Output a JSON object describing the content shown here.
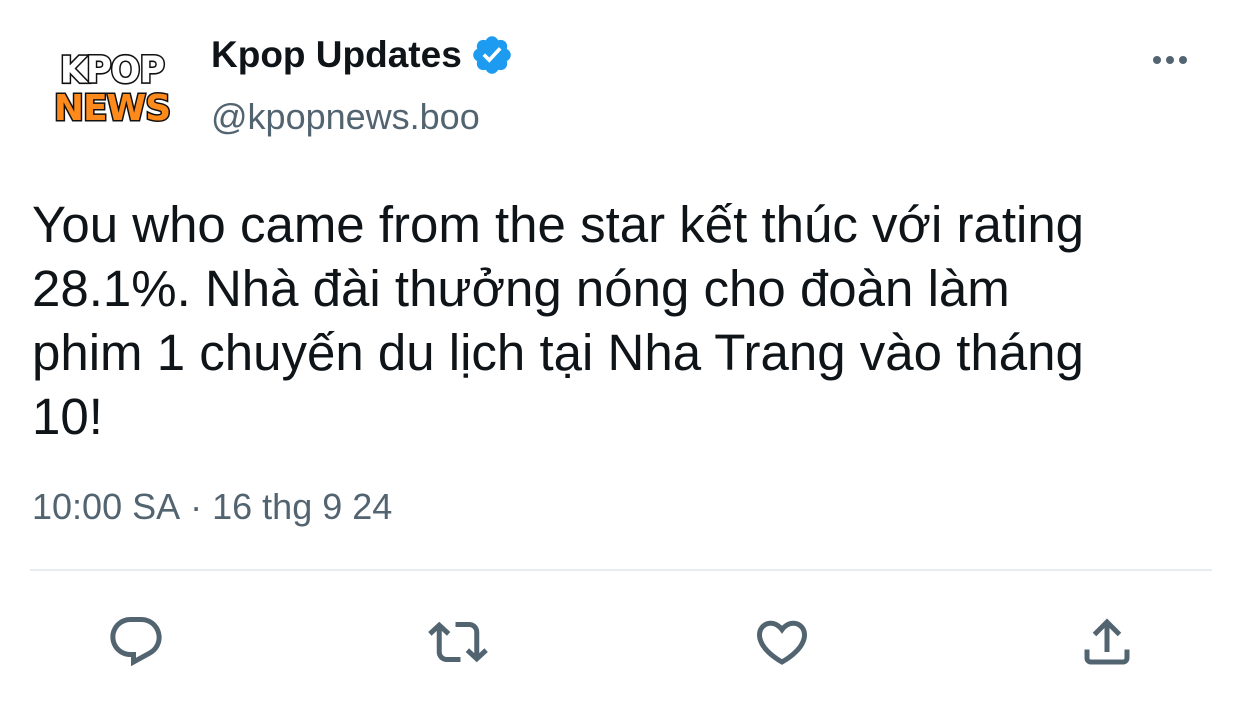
{
  "tweet": {
    "avatar": {
      "line1": "KPOP",
      "line2": "NEWS",
      "colors": {
        "line1": "#ffffff",
        "line2": "#ff8a1c",
        "outline": "#111111"
      }
    },
    "author": {
      "display_name": "Kpop Updates",
      "verified": true,
      "handle": "@kpopnews.boo"
    },
    "text_lines": [
      "You who came from the star kết thúc với rating",
      "28.1%. Nhà đài thưởng nóng cho đoàn làm",
      "phim 1 chuyến du lịch tại Nha Trang vào tháng",
      "10!"
    ],
    "time": "10:00 SA",
    "separator": "·",
    "date": "16 thg 9 24",
    "icons": {
      "verified": "verified-badge-icon",
      "more": "more-options-icon",
      "reply": "reply-icon",
      "retweet": "retweet-icon",
      "like": "heart-icon",
      "share": "share-icon"
    },
    "colors": {
      "accent": "#1d9bf0",
      "text": "#0f1419",
      "secondary": "#536471",
      "divider": "#e6ecf0"
    }
  }
}
